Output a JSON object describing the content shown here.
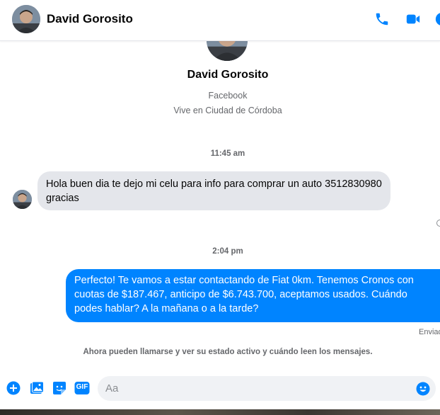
{
  "header": {
    "contact_name": "David Gorosito",
    "icons": [
      "phone-icon",
      "video-camera-icon",
      "info-icon"
    ]
  },
  "profile": {
    "name": "David Gorosito",
    "source": "Facebook",
    "location": "Vive en Ciudad de Córdoba"
  },
  "messages": [
    {
      "timestamp": "11:45 am",
      "direction": "incoming",
      "text": "Hola buen dia te dejo mi celu para info para comprar un auto 3512830980 gracias"
    },
    {
      "timestamp": "2:04 pm",
      "direction": "outgoing",
      "text": "Perfecto! Te vamos a estar contactando de Fiat 0km. Tenemos Cronos con cuotas de $187.467, anticipo de $6.743.700, aceptamos usados. Cuándo podes hablar? A la mañana o a la tarde?",
      "status": "Enviado"
    }
  ],
  "notice": "Ahora pueden llamarse y ver su estado activo y cuándo leen los mensajes.",
  "composer": {
    "placeholder": "Aa",
    "gif_label": "GIF",
    "icons": [
      "plus-icon",
      "photo-icon",
      "sticker-icon",
      "gif-icon",
      "emoji-icon"
    ]
  },
  "colors": {
    "accent": "#0084ff",
    "incoming_bubble": "#e4e6eb",
    "secondary_text": "#65676b"
  }
}
